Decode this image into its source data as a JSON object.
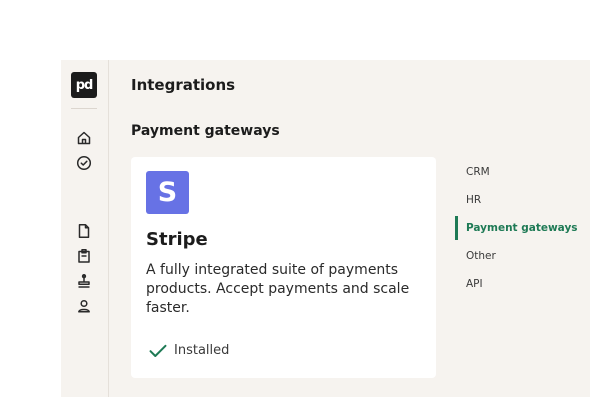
{
  "app": {
    "logo_text": "pd"
  },
  "rail": {
    "icons": [
      "home-icon",
      "check-circle-icon",
      "document-icon",
      "clipboard-icon",
      "stamp-icon",
      "user-icon"
    ]
  },
  "header": {
    "title": "Integrations"
  },
  "section": {
    "title": "Payment gateways"
  },
  "card": {
    "logo_letter": "S",
    "logo_color": "#6772e5",
    "title": "Stripe",
    "description": "A fully integrated suite of payments products. Accept payments and scale faster.",
    "status": "Installed",
    "status_color": "#1e7a55"
  },
  "subnav": {
    "items": [
      {
        "label": "CRM",
        "active": false
      },
      {
        "label": "HR",
        "active": false
      },
      {
        "label": "Payment gateways",
        "active": true
      },
      {
        "label": "Other",
        "active": false
      },
      {
        "label": "API",
        "active": false
      }
    ],
    "accent": "#1e7a55"
  }
}
